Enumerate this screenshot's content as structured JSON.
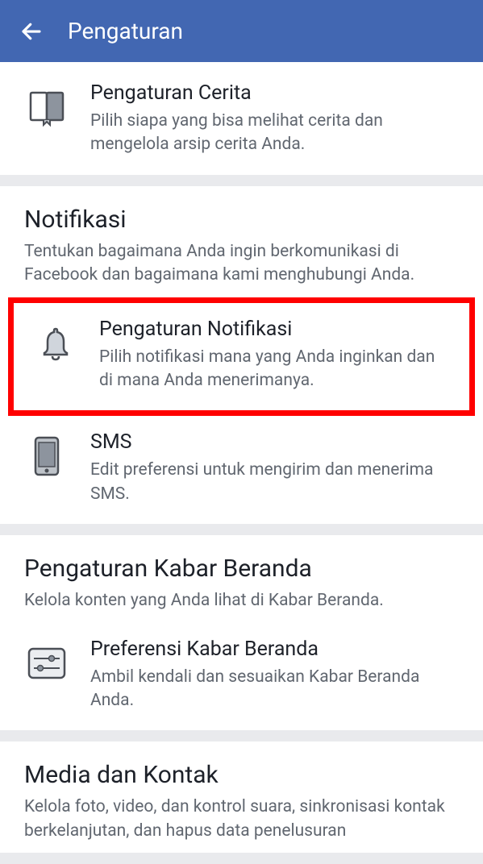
{
  "header": {
    "title": "Pengaturan"
  },
  "sections": {
    "story": {
      "item_title": "Pengaturan Cerita",
      "item_desc": "Pilih siapa yang bisa melihat cerita dan mengelola arsip cerita Anda."
    },
    "notifications": {
      "title": "Notifikasi",
      "desc": "Tentukan bagaimana Anda ingin berkomunikasi di Facebook dan bagaimana kami menghubungi Anda.",
      "item1_title": "Pengaturan Notifikasi",
      "item1_desc": "Pilih notifikasi mana yang Anda inginkan dan di mana Anda menerimanya.",
      "item2_title": "SMS",
      "item2_desc": "Edit preferensi untuk mengirim dan menerima SMS."
    },
    "newsfeed": {
      "title": "Pengaturan Kabar Beranda",
      "desc": "Kelola konten yang Anda lihat di Kabar Beranda.",
      "item1_title": "Preferensi Kabar Beranda",
      "item1_desc": "Ambil kendali dan sesuaikan Kabar Beranda Anda."
    },
    "media": {
      "title": "Media dan Kontak",
      "desc": "Kelola foto, video, dan kontrol suara, sinkronisasi kontak berkelanjutan, dan hapus data penelusuran"
    }
  }
}
